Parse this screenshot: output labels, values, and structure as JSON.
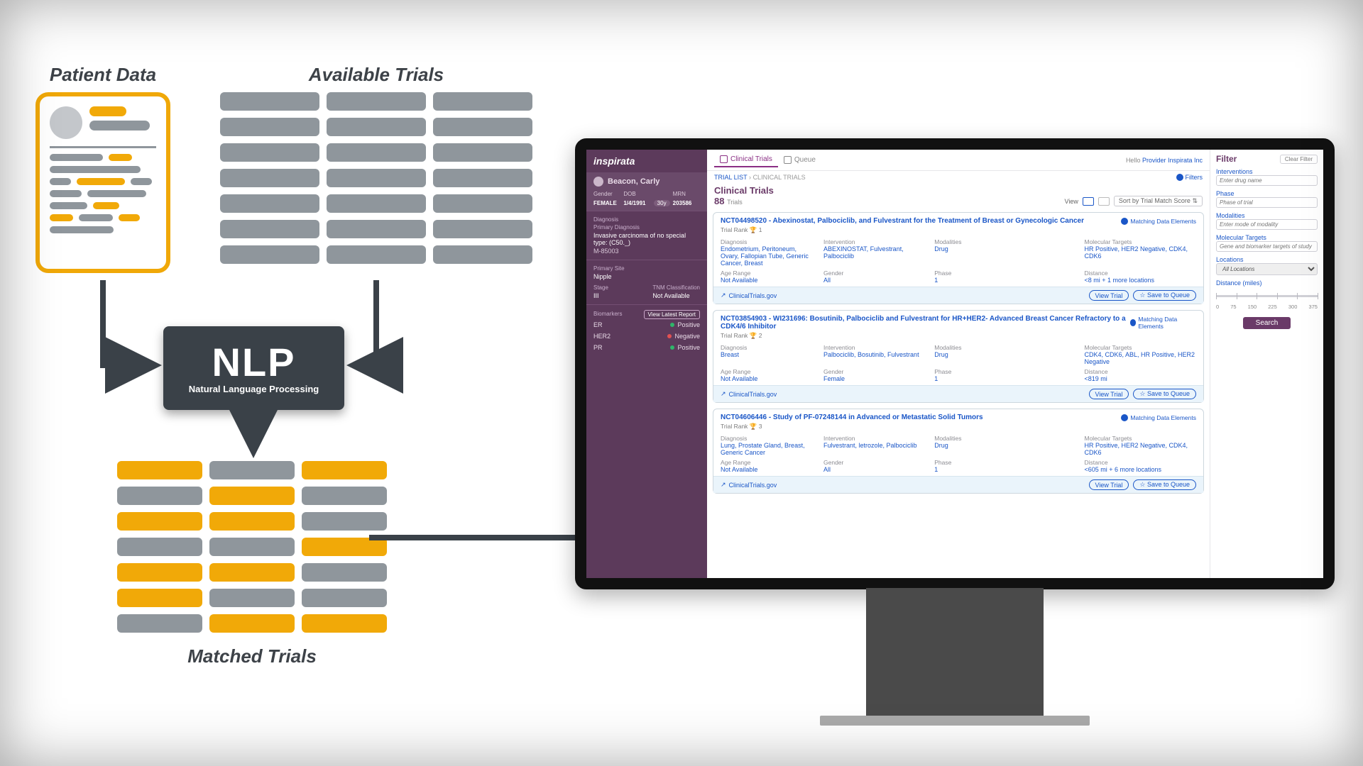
{
  "diagram": {
    "titles": {
      "patient_data": "Patient Data",
      "available_trials": "Available Trials",
      "matched_trials": "Matched Trials"
    },
    "nlp": {
      "big": "NLP",
      "small": "Natural Language Processing"
    }
  },
  "app": {
    "brand": "inspirata",
    "tabs": {
      "clinical": "Clinical Trials",
      "queue": "Queue"
    },
    "hello_prefix": "Hello ",
    "hello_user": "Provider Inspirata Inc",
    "breadcrumb": {
      "root": "TRIAL LIST",
      "current": "CLINICAL TRIALS"
    },
    "filters_link": "Filters",
    "list": {
      "title": "Clinical Trials",
      "count": "88",
      "count_suffix": "Trials",
      "view_label": "View",
      "sort": "Sort by Trial Match Score"
    },
    "card_labels": {
      "rank_prefix": "Trial Rank",
      "diagnosis": "Diagnosis",
      "intervention": "Intervention",
      "modalities": "Modalities",
      "targets": "Molecular Targets",
      "age": "Age Range",
      "gender": "Gender",
      "phase": "Phase",
      "distance": "Distance"
    },
    "footer": {
      "link": "ClinicalTrials.gov",
      "view": "View Trial",
      "save": "Save to Queue"
    },
    "mde_label": "Matching Data Elements",
    "trials": [
      {
        "title": "NCT04498520 - Abexinostat, Palbociclib, and Fulvestrant for the Treatment of Breast or Gynecologic Cancer",
        "rank": "1",
        "diagnosis": "Endometrium, Peritoneum, Ovary, Fallopian Tube, Generic Cancer, Breast",
        "intervention": "ABEXINOSTAT, Fulvestrant, Palbociclib",
        "modalities": "Drug",
        "targets": "HR Positive, HER2 Negative, CDK4, CDK6",
        "age": "Not Available",
        "gender": "All",
        "phase": "1",
        "distance": "<8 mi + 1 more locations"
      },
      {
        "title": "NCT03854903 - WI231696: Bosutinib, Palbociclib and Fulvestrant for HR+HER2- Advanced Breast Cancer Refractory to a CDK4/6 Inhibitor",
        "rank": "2",
        "diagnosis": "Breast",
        "intervention": "Palbociclib, Bosutinib, Fulvestrant",
        "modalities": "Drug",
        "targets": "CDK4, CDK6, ABL, HR Positive, HER2 Negative",
        "age": "Not Available",
        "gender": "Female",
        "phase": "1",
        "distance": "<819 mi"
      },
      {
        "title": "NCT04606446 - Study of PF-07248144 in Advanced or Metastatic Solid Tumors",
        "rank": "3",
        "diagnosis": "Lung, Prostate Gland, Breast, Generic Cancer",
        "intervention": "Fulvestrant, letrozole, Palbociclib",
        "modalities": "Drug",
        "targets": "HR Positive, HER2 Negative, CDK4, CDK6",
        "age": "Not Available",
        "gender": "All",
        "phase": "1",
        "distance": "<605 mi + 6 more locations"
      }
    ],
    "patient": {
      "name": "Beacon, Carly",
      "labels": {
        "gender": "Gender",
        "dob": "DOB",
        "age_suffix": "y",
        "mrn": "MRN"
      },
      "gender": "FEMALE",
      "dob": "1/4/1991",
      "age": "30",
      "mrn": "203586",
      "diag_h": "Diagnosis",
      "primary_h": "Primary Diagnosis",
      "primary_v": "Invasive carcinoma of no special type: (C50._)",
      "mcode": "M-85003",
      "site_h": "Primary Site",
      "site_v": "Nipple",
      "stage_h": "Stage",
      "stage_v": "III",
      "tnm_h": "TNM Classification",
      "tnm_v": "Not Available",
      "biom_h": "Biomarkers",
      "vlr": "View Latest Report",
      "biomarkers": [
        {
          "k": "ER",
          "v": "Positive",
          "s": "green"
        },
        {
          "k": "HER2",
          "v": "Negative",
          "s": "red"
        },
        {
          "k": "PR",
          "v": "Positive",
          "s": "green"
        }
      ]
    },
    "filters": {
      "title": "Filter",
      "clear": "Clear Filter",
      "interventions": "Interventions",
      "interventions_ph": "Enter drug name",
      "phase": "Phase",
      "phase_ph": "Phase of trial",
      "modalities": "Modalities",
      "modalities_ph": "Enter mode of modality",
      "targets": "Molecular Targets",
      "targets_ph": "Gene and biomarker targets of study",
      "locations": "Locations",
      "locations_opt": "All Locations",
      "distance": "Distance (miles)",
      "ticks": [
        "0",
        "75",
        "150",
        "225",
        "300",
        "375"
      ],
      "search": "Search"
    }
  }
}
